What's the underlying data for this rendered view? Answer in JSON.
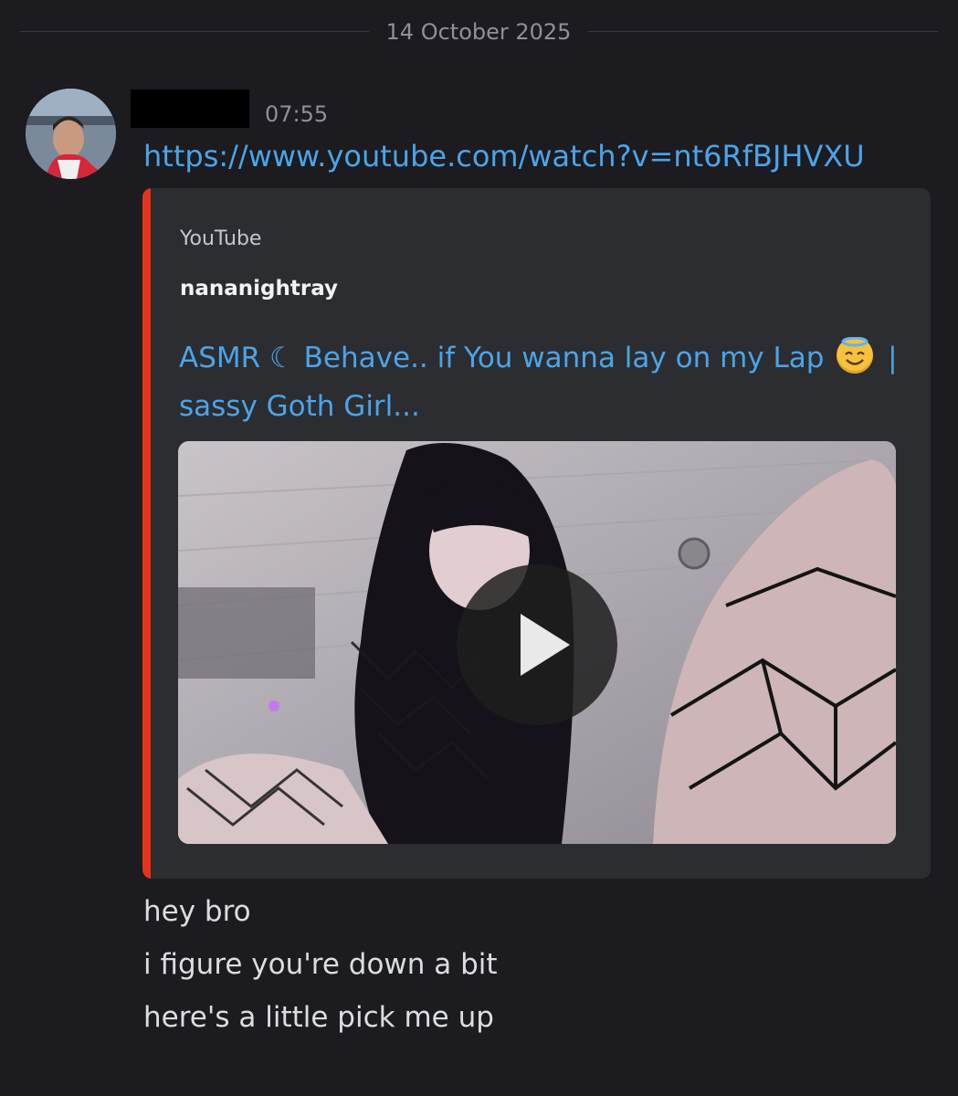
{
  "date_divider": "14 October 2025",
  "message": {
    "timestamp": "07:55",
    "link_text": "https://www.youtube.com/watch?v=nt6RfBJHVXU",
    "embed": {
      "provider": "YouTube",
      "author": "nananightray",
      "title_part1": "ASMR ☾ Behave.. if You wanna lay on my Lap",
      "title_part2": "|",
      "title_part3": "sassy Goth Girl...",
      "title_emoji": "smiling-face-with-halo",
      "accent_color": "#e5331c"
    },
    "lines": [
      "hey bro",
      "i figure you're down a bit",
      "here's a little pick me up"
    ]
  },
  "colors": {
    "background": "#1b1b20",
    "embed_background": "#2b2d31",
    "link": "#4ba4e8",
    "muted": "#8e9199"
  }
}
